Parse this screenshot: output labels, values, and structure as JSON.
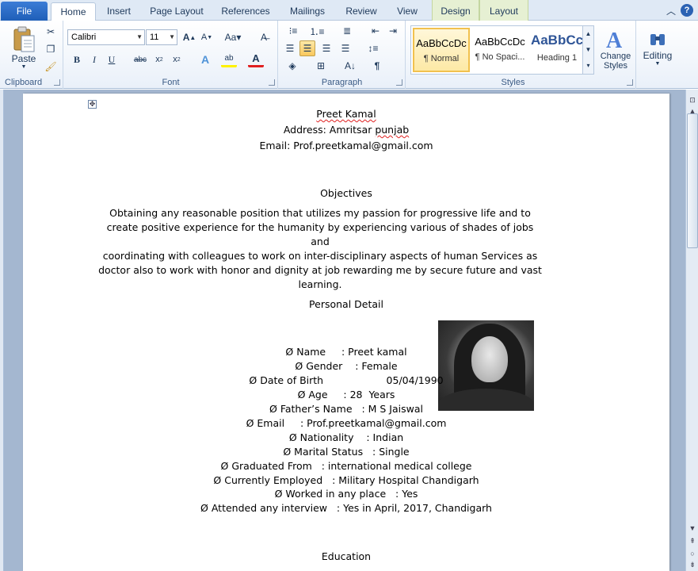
{
  "ribbon": {
    "tabs": [
      {
        "label": "File"
      },
      {
        "label": "Home"
      },
      {
        "label": "Insert"
      },
      {
        "label": "Page Layout"
      },
      {
        "label": "References"
      },
      {
        "label": "Mailings"
      },
      {
        "label": "Review"
      },
      {
        "label": "View"
      },
      {
        "label": "Design"
      },
      {
        "label": "Layout"
      }
    ],
    "clipboard": {
      "paste_label": "Paste",
      "group_label": "Clipboard"
    },
    "font": {
      "font_name": "Calibri",
      "font_size": "11",
      "group_label": "Font"
    },
    "paragraph": {
      "group_label": "Paragraph"
    },
    "styles": {
      "items": [
        {
          "sample": "AaBbCcDc",
          "name": "¶ Normal"
        },
        {
          "sample": "AaBbCcDc",
          "name": "¶ No Spaci..."
        },
        {
          "sample": "AaBbCc",
          "name": "Heading 1"
        }
      ],
      "change_styles_label": "Change Styles",
      "group_label": "Styles"
    },
    "editing": {
      "label": "Editing"
    }
  },
  "document": {
    "header_name": "Preet Kamal",
    "address_label": "Address: Amritsar ",
    "address_city": "punjab",
    "email_line": "Email: Prof.preetkamal@gmail.com",
    "objectives_heading": "Objectives",
    "objective_lines": [
      "Obtaining any reasonable position that utilizes my passion for progressive life and to",
      "create positive experience for the humanity by experiencing various of shades of jobs and",
      "coordinating with colleagues to work on inter-disciplinary aspects of human Services as",
      "doctor also to work with honor and dignity at job rewarding me by secure future and vast",
      "learning."
    ],
    "personal_heading": "Personal Detail",
    "details": [
      "Ø Name     : Preet kamal",
      "Ø Gender    : Female",
      "Ø Date of Birth                    05/04/1990",
      "Ø Age     : 28  Years",
      "Ø Father’s Name   : M S Jaiswal",
      "Ø Email     : Prof.preetkamal@gmail.com",
      "Ø Nationality    : Indian",
      "Ø Marital Status   : Single",
      "Ø Graduated From   : international medical college",
      "Ø Currently Employed   : Military Hospital Chandigarh",
      "Ø Worked in any place   : Yes",
      "Ø Attended any interview   : Yes in April, 2017, Chandigarh"
    ],
    "education_heading": "Education"
  }
}
